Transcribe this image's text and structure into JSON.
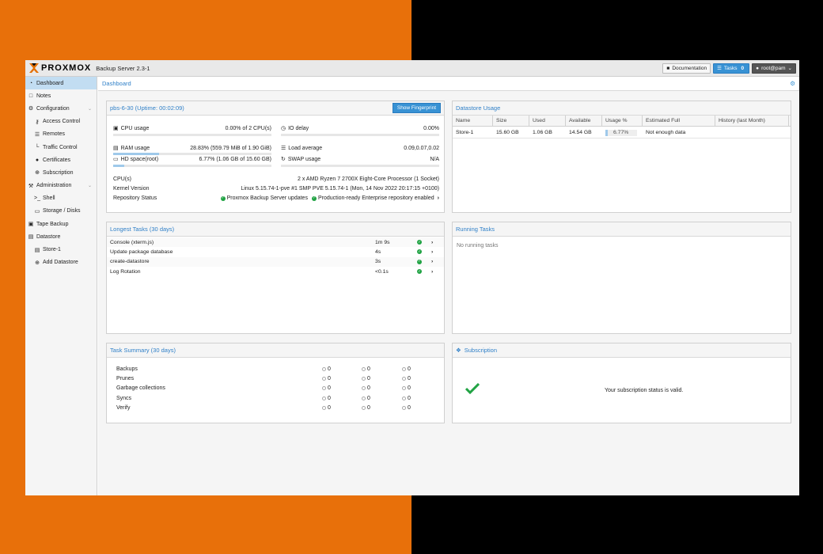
{
  "header": {
    "logo_text": "PROXMOX",
    "product": "Backup Server 2.3-1",
    "documentation_label": "Documentation",
    "tasks_label": "Tasks",
    "tasks_count": "0",
    "user_label": "root@pam"
  },
  "sidebar": {
    "items": [
      {
        "label": "Dashboard",
        "sub": false,
        "active": true,
        "icon": "dashboard-icon"
      },
      {
        "label": "Notes",
        "sub": false,
        "icon": "notes-icon"
      },
      {
        "label": "Configuration",
        "sub": false,
        "icon": "gears-icon",
        "expandable": true
      },
      {
        "label": "Access Control",
        "sub": true,
        "icon": "key-icon"
      },
      {
        "label": "Remotes",
        "sub": true,
        "icon": "server-icon"
      },
      {
        "label": "Traffic Control",
        "sub": true,
        "icon": "chart-icon"
      },
      {
        "label": "Certificates",
        "sub": true,
        "icon": "certificate-icon"
      },
      {
        "label": "Subscription",
        "sub": true,
        "icon": "support-icon"
      },
      {
        "label": "Administration",
        "sub": false,
        "icon": "wrench-icon",
        "expandable": true
      },
      {
        "label": "Shell",
        "sub": true,
        "icon": "terminal-icon"
      },
      {
        "label": "Storage / Disks",
        "sub": true,
        "icon": "hdd-icon"
      },
      {
        "label": "Tape Backup",
        "sub": false,
        "icon": "tape-icon"
      },
      {
        "label": "Datastore",
        "sub": false,
        "icon": "database-icon"
      },
      {
        "label": "Store-1",
        "sub": true,
        "icon": "database-icon"
      },
      {
        "label": "Add Datastore",
        "sub": true,
        "icon": "plus-circle-icon"
      }
    ]
  },
  "breadcrumb": "Dashboard",
  "server": {
    "title": "pbs-6-30 (Uptime: 00:02:09)",
    "fingerprint_button": "Show Fingerprint",
    "cpu_label": "CPU usage",
    "cpu_value": "0.00% of 2 CPU(s)",
    "cpu_fraction": 0.0,
    "io_label": "IO delay",
    "io_value": "0.00%",
    "io_fraction": 0.0,
    "ram_label": "RAM usage",
    "ram_value": "28.83% (559.79 MiB of 1.90 GiB)",
    "ram_fraction": 0.2883,
    "load_label": "Load average",
    "load_value": "0.09,0.07,0.02",
    "hd_label": "HD space(root)",
    "hd_value": "6.77% (1.06 GB of 15.60 GB)",
    "hd_fraction": 0.0677,
    "swap_label": "SWAP usage",
    "swap_value": "N/A",
    "swap_fraction": 0.0,
    "cpus_label": "CPU(s)",
    "cpus_value": "2 x AMD Ryzen 7 2700X Eight-Core Processor (1 Socket)",
    "kernel_label": "Kernel Version",
    "kernel_value": "Linux 5.15.74-1-pve #1 SMP PVE 5.15.74-1 (Mon, 14 Nov 2022 20:17:15 +0100)",
    "repo_label": "Repository Status",
    "repo_status_1": "Proxmox Backup Server updates",
    "repo_status_2": "Production-ready Enterprise repository enabled"
  },
  "datastore": {
    "title": "Datastore Usage",
    "columns": [
      "Name",
      "Size",
      "Used",
      "Available",
      "Usage %",
      "Estimated Full",
      "History (last Month)"
    ],
    "rows": [
      {
        "name": "Store-1",
        "size": "15.60 GB",
        "used": "1.06 GB",
        "available": "14.54 GB",
        "usage": "6.77%",
        "usage_fraction": 0.0677,
        "estimated": "Not enough data",
        "history": ""
      }
    ]
  },
  "longest_tasks": {
    "title": "Longest Tasks (30 days)",
    "rows": [
      {
        "name": "Console (xterm.js)",
        "duration": "1m 9s"
      },
      {
        "name": "Update package database",
        "duration": "4s"
      },
      {
        "name": "create-datastore",
        "duration": "3s"
      },
      {
        "name": "Log Rotation",
        "duration": "<0.1s"
      }
    ]
  },
  "running_tasks": {
    "title": "Running Tasks",
    "empty": "No running tasks"
  },
  "task_summary": {
    "title": "Task Summary (30 days)",
    "rows": [
      {
        "name": "Backups",
        "a": "0",
        "b": "0",
        "c": "0"
      },
      {
        "name": "Prunes",
        "a": "0",
        "b": "0",
        "c": "0"
      },
      {
        "name": "Garbage collections",
        "a": "0",
        "b": "0",
        "c": "0"
      },
      {
        "name": "Syncs",
        "a": "0",
        "b": "0",
        "c": "0"
      },
      {
        "name": "Verify",
        "a": "0",
        "b": "0",
        "c": "0"
      }
    ]
  },
  "subscription": {
    "title": "Subscription",
    "status": "Your subscription status is valid."
  },
  "colors": {
    "accent": "#3892d4",
    "link": "#3080c8",
    "ok": "#21a344",
    "brand_orange": "#e8700a"
  }
}
